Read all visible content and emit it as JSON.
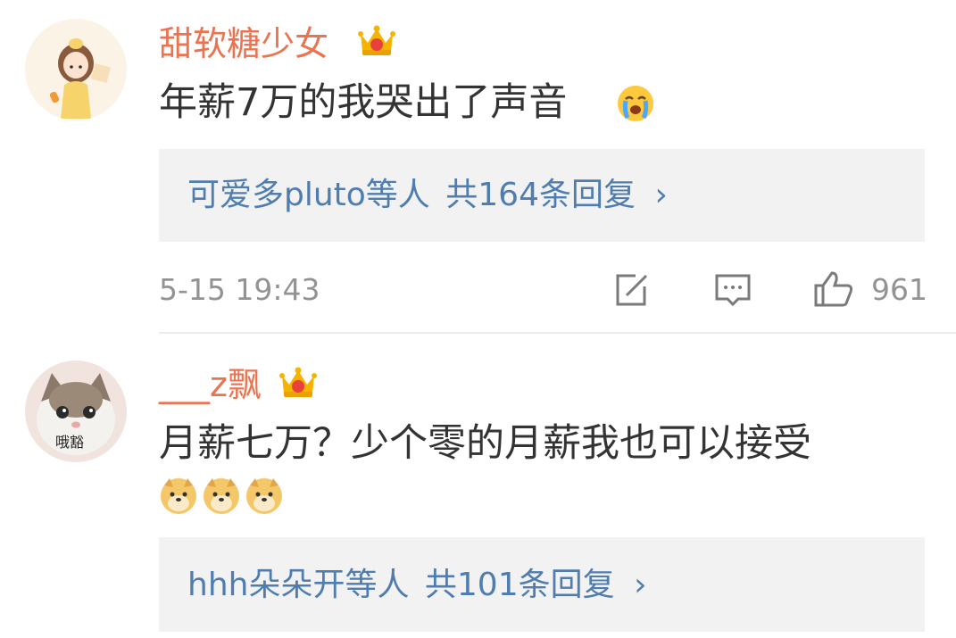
{
  "comments": [
    {
      "username": "甜软糖少女",
      "text": "年薪7万的我哭出了声音",
      "reply_prefix": "可爱多pluto等人",
      "reply_count": "共164条回复",
      "reply_chevron": "›",
      "timestamp": "5-15 19:43",
      "likes": "961"
    },
    {
      "username": "___z飘",
      "avatar_caption": "哦豁",
      "text": "月薪七万？少个零的月薪我也可以接受",
      "reply_prefix": "hhh朵朵开等人",
      "reply_count": "共101条回复",
      "reply_chevron": "›"
    }
  ],
  "icons": [
    "crown-icon",
    "crying-emoji-icon",
    "share-icon",
    "comment-icon",
    "like-icon",
    "doge-emoji-icon"
  ],
  "colors": {
    "username": "#eb7350",
    "link": "#507daf",
    "meta": "#939393",
    "text": "#333333",
    "reply_bg": "#f2f2f2",
    "crown": "#f5b400"
  }
}
